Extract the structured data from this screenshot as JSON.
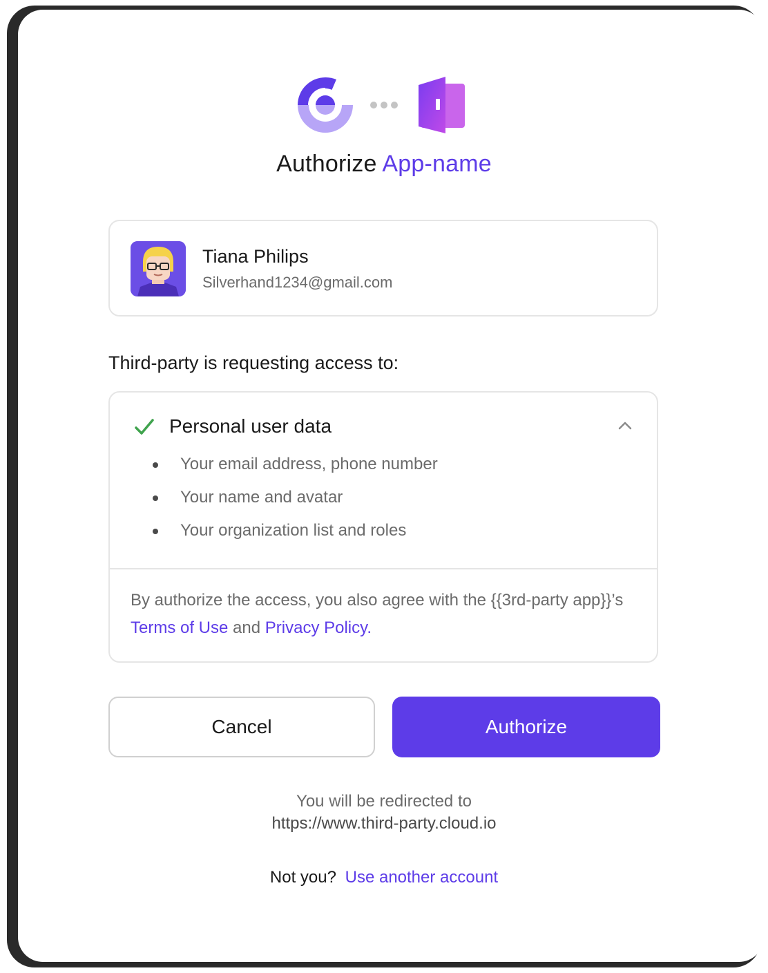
{
  "header": {
    "title_prefix": "Authorize",
    "app_name": "App-name"
  },
  "user": {
    "name": "Tiana Philips",
    "email": "Silverhand1234@gmail.com"
  },
  "request": {
    "label": "Third-party is requesting access to:",
    "scope_title": "Personal user data",
    "items": [
      "Your email address, phone number",
      "Your name and avatar",
      "Your organization list and roles"
    ],
    "terms_text_before": "By authorize the access, you also agree with the {{3rd-party app}}’s",
    "terms_link": "Terms of Use",
    "terms_and": "and",
    "privacy_link": "Privacy Policy",
    "terms_end": "."
  },
  "buttons": {
    "cancel": "Cancel",
    "authorize": "Authorize"
  },
  "redirect": {
    "line1": "You will be redirected to",
    "url": "https://www.third-party.cloud.io"
  },
  "footer": {
    "not_you": "Not you?",
    "switch_link": "Use another account"
  },
  "colors": {
    "accent": "#5d3ce8",
    "check": "#3fa34d"
  },
  "icons": [
    "app-logo-icon",
    "connect-dots-icon",
    "door-icon",
    "check-icon",
    "chevron-up-icon"
  ]
}
